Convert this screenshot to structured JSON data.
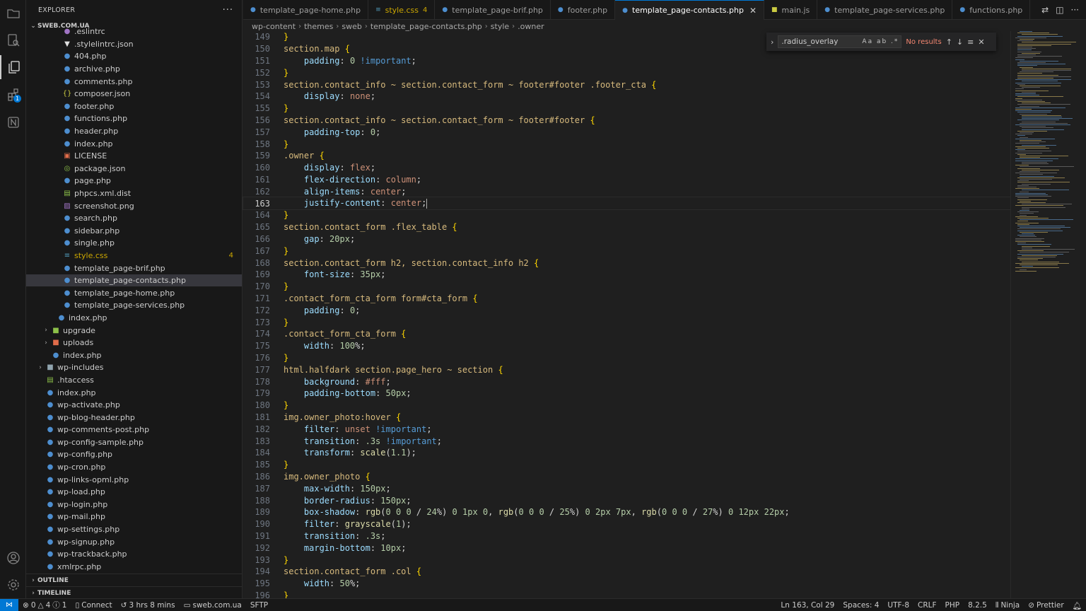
{
  "sidebar": {
    "title": "EXPLORER",
    "more": "···",
    "root": "SWEB.COM.UA",
    "files": [
      {
        "name": ".eslintrc",
        "icon": "eslint-icon",
        "glyph": "●",
        "cls": "ic-png",
        "indent": 4
      },
      {
        "name": ".stylelintrc.json",
        "icon": "stylelint-icon",
        "glyph": "▼",
        "cls": "ic-lint",
        "indent": 4
      },
      {
        "name": "404.php",
        "icon": "php-file-icon",
        "glyph": "●",
        "cls": "ic-php",
        "indent": 4
      },
      {
        "name": "archive.php",
        "icon": "php-file-icon",
        "glyph": "●",
        "cls": "ic-php",
        "indent": 4
      },
      {
        "name": "comments.php",
        "icon": "php-file-icon",
        "glyph": "●",
        "cls": "ic-php",
        "indent": 4
      },
      {
        "name": "composer.json",
        "icon": "json-file-icon",
        "glyph": "{}",
        "cls": "ic-json",
        "indent": 4
      },
      {
        "name": "footer.php",
        "icon": "php-file-icon",
        "glyph": "●",
        "cls": "ic-php",
        "indent": 4
      },
      {
        "name": "functions.php",
        "icon": "php-file-icon",
        "glyph": "●",
        "cls": "ic-php",
        "indent": 4
      },
      {
        "name": "header.php",
        "icon": "php-file-icon",
        "glyph": "●",
        "cls": "ic-php",
        "indent": 4
      },
      {
        "name": "index.php",
        "icon": "php-file-icon",
        "glyph": "●",
        "cls": "ic-php",
        "indent": 4
      },
      {
        "name": "LICENSE",
        "icon": "license-icon",
        "glyph": "▣",
        "cls": "ic-lic",
        "indent": 4
      },
      {
        "name": "package.json",
        "icon": "npm-package-icon",
        "glyph": "◎",
        "cls": "ic-pkg",
        "indent": 4
      },
      {
        "name": "page.php",
        "icon": "php-file-icon",
        "glyph": "●",
        "cls": "ic-php",
        "indent": 4
      },
      {
        "name": "phpcs.xml.dist",
        "icon": "xml-file-icon",
        "glyph": "▤",
        "cls": "ic-xml",
        "indent": 4
      },
      {
        "name": "screenshot.png",
        "icon": "image-file-icon",
        "glyph": "▨",
        "cls": "ic-png",
        "indent": 4
      },
      {
        "name": "search.php",
        "icon": "php-file-icon",
        "glyph": "●",
        "cls": "ic-php",
        "indent": 4
      },
      {
        "name": "sidebar.php",
        "icon": "php-file-icon",
        "glyph": "●",
        "cls": "ic-php",
        "indent": 4
      },
      {
        "name": "single.php",
        "icon": "php-file-icon",
        "glyph": "●",
        "cls": "ic-php",
        "indent": 4
      },
      {
        "name": "style.css",
        "icon": "css-file-icon",
        "glyph": "≡",
        "cls": "ic-css",
        "indent": 4,
        "modified": true,
        "count": "4"
      },
      {
        "name": "template_page-brif.php",
        "icon": "php-file-icon",
        "glyph": "●",
        "cls": "ic-php",
        "indent": 4
      },
      {
        "name": "template_page-contacts.php",
        "icon": "php-file-icon",
        "glyph": "●",
        "cls": "ic-php",
        "indent": 4,
        "selected": true
      },
      {
        "name": "template_page-home.php",
        "icon": "php-file-icon",
        "glyph": "●",
        "cls": "ic-php",
        "indent": 4
      },
      {
        "name": "template_page-services.php",
        "icon": "php-file-icon",
        "glyph": "●",
        "cls": "ic-php",
        "indent": 4
      },
      {
        "name": "index.php",
        "icon": "php-file-icon",
        "glyph": "●",
        "cls": "ic-php",
        "indent": 3
      },
      {
        "name": "upgrade",
        "icon": "folder-icon",
        "glyph": "■",
        "cls": "ic-fold-g",
        "indent": 2,
        "folder": true
      },
      {
        "name": "uploads",
        "icon": "folder-icon",
        "glyph": "■",
        "cls": "ic-fold-r",
        "indent": 2,
        "folder": true
      },
      {
        "name": "index.php",
        "icon": "php-file-icon",
        "glyph": "●",
        "cls": "ic-php",
        "indent": 2
      },
      {
        "name": "wp-includes",
        "icon": "folder-icon",
        "glyph": "■",
        "cls": "ic-fold",
        "indent": 1,
        "folder": true
      },
      {
        "name": ".htaccess",
        "icon": "htaccess-icon",
        "glyph": "▤",
        "cls": "ic-hta",
        "indent": 1
      },
      {
        "name": "index.php",
        "icon": "php-file-icon",
        "glyph": "●",
        "cls": "ic-php",
        "indent": 1
      },
      {
        "name": "wp-activate.php",
        "icon": "php-file-icon",
        "glyph": "●",
        "cls": "ic-php",
        "indent": 1
      },
      {
        "name": "wp-blog-header.php",
        "icon": "php-file-icon",
        "glyph": "●",
        "cls": "ic-php",
        "indent": 1
      },
      {
        "name": "wp-comments-post.php",
        "icon": "php-file-icon",
        "glyph": "●",
        "cls": "ic-php",
        "indent": 1
      },
      {
        "name": "wp-config-sample.php",
        "icon": "php-file-icon",
        "glyph": "●",
        "cls": "ic-php",
        "indent": 1
      },
      {
        "name": "wp-config.php",
        "icon": "php-file-icon",
        "glyph": "●",
        "cls": "ic-php",
        "indent": 1
      },
      {
        "name": "wp-cron.php",
        "icon": "php-file-icon",
        "glyph": "●",
        "cls": "ic-php",
        "indent": 1
      },
      {
        "name": "wp-links-opml.php",
        "icon": "php-file-icon",
        "glyph": "●",
        "cls": "ic-php",
        "indent": 1
      },
      {
        "name": "wp-load.php",
        "icon": "php-file-icon",
        "glyph": "●",
        "cls": "ic-php",
        "indent": 1
      },
      {
        "name": "wp-login.php",
        "icon": "php-file-icon",
        "glyph": "●",
        "cls": "ic-php",
        "indent": 1
      },
      {
        "name": "wp-mail.php",
        "icon": "php-file-icon",
        "glyph": "●",
        "cls": "ic-php",
        "indent": 1
      },
      {
        "name": "wp-settings.php",
        "icon": "php-file-icon",
        "glyph": "●",
        "cls": "ic-php",
        "indent": 1
      },
      {
        "name": "wp-signup.php",
        "icon": "php-file-icon",
        "glyph": "●",
        "cls": "ic-php",
        "indent": 1
      },
      {
        "name": "wp-trackback.php",
        "icon": "php-file-icon",
        "glyph": "●",
        "cls": "ic-php",
        "indent": 1
      },
      {
        "name": "xmlrpc.php",
        "icon": "php-file-icon",
        "glyph": "●",
        "cls": "ic-php",
        "indent": 1
      }
    ],
    "outline": "OUTLINE",
    "timeline": "TIMELINE"
  },
  "activity": {
    "extensions_badge": "1"
  },
  "tabs": [
    {
      "label": "template_page-home.php",
      "kind": "php"
    },
    {
      "label": "style.css",
      "kind": "css",
      "modified": true,
      "count": "4"
    },
    {
      "label": "template_page-brif.php",
      "kind": "php"
    },
    {
      "label": "footer.php",
      "kind": "php"
    },
    {
      "label": "template_page-contacts.php",
      "kind": "php",
      "active": true
    },
    {
      "label": "main.js",
      "kind": "js"
    },
    {
      "label": "template_page-services.php",
      "kind": "php"
    },
    {
      "label": "functions.php",
      "kind": "php"
    }
  ],
  "breadcrumb": [
    "wp-content",
    "themes",
    "sweb",
    "template_page-contacts.php",
    "style",
    ".owner"
  ],
  "find": {
    "value": ".radius_overlay",
    "options": "Aa ab .*",
    "status": "No results"
  },
  "code": {
    "current_line": 163,
    "lines": [
      {
        "n": "149",
        "t": "}"
      },
      {
        "n": "150",
        "t": "section.map {"
      },
      {
        "n": "151",
        "t": "    padding: 0 !important;"
      },
      {
        "n": "152",
        "t": "}"
      },
      {
        "n": "153",
        "t": "section.contact_info ~ section.contact_form ~ footer#footer .footer_cta {"
      },
      {
        "n": "154",
        "t": "    display: none;"
      },
      {
        "n": "155",
        "t": "}"
      },
      {
        "n": "156",
        "t": "section.contact_info ~ section.contact_form ~ footer#footer {"
      },
      {
        "n": "157",
        "t": "    padding-top: 0;"
      },
      {
        "n": "158",
        "t": "}"
      },
      {
        "n": "159",
        "t": ".owner {"
      },
      {
        "n": "160",
        "t": "    display: flex;"
      },
      {
        "n": "161",
        "t": "    flex-direction: column;"
      },
      {
        "n": "162",
        "t": "    align-items: center;"
      },
      {
        "n": "163",
        "t": "    justify-content: center;"
      },
      {
        "n": "164",
        "t": "}"
      },
      {
        "n": "165",
        "t": "section.contact_form .flex_table {"
      },
      {
        "n": "166",
        "t": "    gap: 20px;"
      },
      {
        "n": "167",
        "t": "}"
      },
      {
        "n": "168",
        "t": "section.contact_form h2, section.contact_info h2 {"
      },
      {
        "n": "169",
        "t": "    font-size: 35px;"
      },
      {
        "n": "170",
        "t": "}"
      },
      {
        "n": "171",
        "t": ".contact_form_cta_form form#cta_form {"
      },
      {
        "n": "172",
        "t": "    padding: 0;"
      },
      {
        "n": "173",
        "t": "}"
      },
      {
        "n": "174",
        "t": ".contact_form_cta_form {"
      },
      {
        "n": "175",
        "t": "    width: 100%;"
      },
      {
        "n": "176",
        "t": "}"
      },
      {
        "n": "177",
        "t": "html.halfdark section.page_hero ~ section {"
      },
      {
        "n": "178",
        "t": "    background: #fff;"
      },
      {
        "n": "179",
        "t": "    padding-bottom: 50px;"
      },
      {
        "n": "180",
        "t": "}"
      },
      {
        "n": "181",
        "t": "img.owner_photo:hover {"
      },
      {
        "n": "182",
        "t": "    filter: unset !important;"
      },
      {
        "n": "183",
        "t": "    transition: .3s !important;"
      },
      {
        "n": "184",
        "t": "    transform: scale(1.1);"
      },
      {
        "n": "185",
        "t": "}"
      },
      {
        "n": "186",
        "t": "img.owner_photo {"
      },
      {
        "n": "187",
        "t": "    max-width: 150px;"
      },
      {
        "n": "188",
        "t": "    border-radius: 150px;"
      },
      {
        "n": "189",
        "t": "    box-shadow: rgb(0 0 0 / 24%) 0 1px 0, rgb(0 0 0 / 25%) 0 2px 7px, rgb(0 0 0 / 27%) 0 12px 22px;"
      },
      {
        "n": "190",
        "t": "    filter: grayscale(1);"
      },
      {
        "n": "191",
        "t": "    transition: .3s;"
      },
      {
        "n": "192",
        "t": "    margin-bottom: 10px;"
      },
      {
        "n": "193",
        "t": "}"
      },
      {
        "n": "194",
        "t": "section.contact_form .col {"
      },
      {
        "n": "195",
        "t": "    width: 50%;"
      },
      {
        "n": "196",
        "t": "}"
      }
    ]
  },
  "status": {
    "errors": "0",
    "warnings": "4",
    "info": "1",
    "connect": "Connect",
    "time": "3 hrs 8 mins",
    "host": "sweb.com.ua",
    "sftp": "SFTP",
    "position": "Ln 163, Col 29",
    "spaces": "Spaces: 4",
    "encoding": "UTF-8",
    "eol": "CRLF",
    "language": "PHP",
    "php_version": "8.2.5",
    "ninja": "Ninja",
    "prettier": "Prettier"
  },
  "colors": {
    "accent": "#0078d4",
    "modified": "#cca700",
    "error": "#f48771"
  }
}
